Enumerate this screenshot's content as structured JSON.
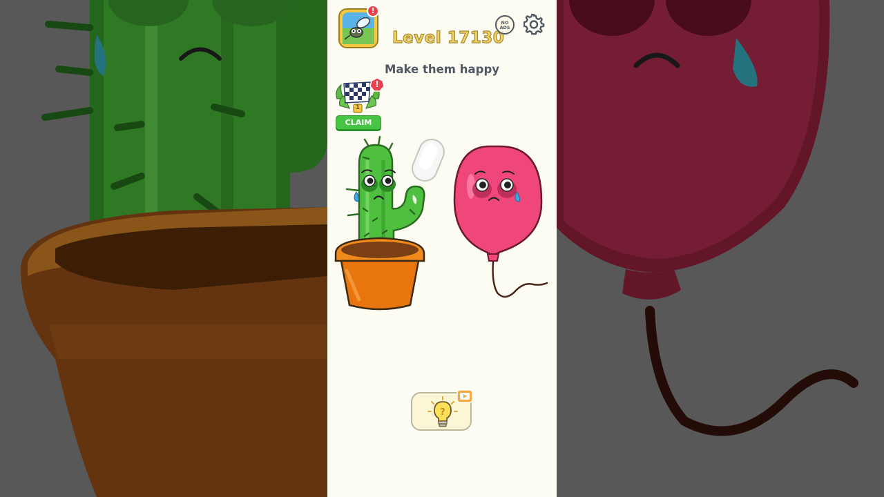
{
  "game": {
    "level_label": "Level 17130",
    "instruction": "Make them happy",
    "claim_label": "CLAIM",
    "no_ads_label_line1": "NO",
    "no_ads_label_line2": "ADS",
    "trophy_rank": "1",
    "alert_mark": "!"
  },
  "icons": {
    "profile": "mosquito-avatar-icon",
    "settings": "gear-icon",
    "no_ads": "no-ads-icon",
    "hint": "lightbulb-icon",
    "video": "video-play-icon",
    "reward": "checkered-flag-trophy-icon"
  },
  "colors": {
    "background": "#fdfcf2",
    "level_text": "#f3d26a",
    "instruction_text": "#4f5862",
    "claim_button": "#47c444",
    "alert_badge": "#e8424f",
    "cactus": "#4fbf3f",
    "pot": "#f08a1c",
    "balloon": "#f0477a"
  },
  "characters": [
    {
      "name": "cactus",
      "mood": "sad"
    },
    {
      "name": "balloon",
      "mood": "sad"
    }
  ]
}
